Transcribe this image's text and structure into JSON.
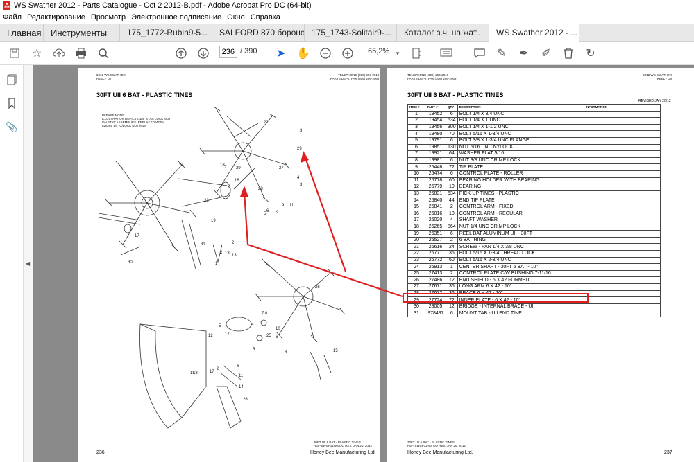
{
  "window": {
    "title": "WS Swather 2012 - Parts Catalogue - Oct 2 2012-B.pdf - Adobe Acrobat Pro DC (64-bit)"
  },
  "menu": [
    "Файл",
    "Редактирование",
    "Просмотр",
    "Электронное подписание",
    "Окно",
    "Справка"
  ],
  "tabs": {
    "home": "Главная",
    "tools": "Инструменты",
    "docs": [
      "175_1772-Rubin9-5...",
      "SALFORD 870 бороно...",
      "175_1743-Solitair9-...",
      "Каталог з.ч. на жат..."
    ],
    "active": "WS Swather 2012 - ...",
    "close": "×"
  },
  "toolbar": {
    "page_current": "236",
    "page_total": "/  390",
    "zoom": "65,2%"
  },
  "left_page": {
    "header_left_1": "2012 WS SWATHER",
    "header_left_2": "REEL - UII",
    "header_right_1": "TELEPHONE (306) 296-2019",
    "header_right_2": "PARTS DEPT. FAX (306) 296-2069",
    "title": "30FT UII 6 BAT - PLASTIC TINES",
    "note": [
      "PLEASE NOTE:",
      "ILLUSTRATION DEPICTS 1/4\" STAR LOCK NUT",
      "ON STAR ASSEMBLIES. REPLACED WITH",
      "826265 1/4\" C/LOCK NUT (#18)"
    ],
    "footer_ref_1": "30FT UII 6 BAT - PLASTIC TINES",
    "footer_ref_2": "REF-SWSP12WS DO REV. JAN 20, 2012",
    "page_no": "236",
    "company": "Honey Bee Manufacturing Ltd.",
    "callouts": [
      "22",
      "17",
      "3",
      "29",
      "18",
      "24",
      "18",
      "29",
      "27",
      "28",
      "4",
      "3",
      "9",
      "5",
      "23",
      "6",
      "9",
      "11",
      "19",
      "17",
      "31",
      "2",
      "1",
      "2",
      "13",
      "30",
      "13",
      "26",
      "5",
      "17",
      "4",
      "7",
      "8",
      "10",
      "5",
      "25",
      "6",
      "8",
      "12",
      "18",
      "17",
      "11",
      "6",
      "14",
      "18",
      "2",
      "26",
      "15"
    ]
  },
  "right_page": {
    "header_left_1": "TELEPHONE (306) 296-2019",
    "header_left_2": "PARTS DEPT. FAX (306) 296-2069",
    "header_right_1": "2012 WS SWATHER",
    "header_right_2": "REEL - UII",
    "title": "30FT UII 6 BAT - PLASTIC TINES",
    "revised": "REVISED JAN 20/12",
    "columns": [
      "ITEM #",
      "PART #",
      "QTY",
      "DESCRIPTION",
      "INFORMATION"
    ],
    "rows": [
      [
        "1",
        "19452",
        "6",
        "BOLT 1/4 X 3/4 UNC",
        ""
      ],
      [
        "2",
        "19454",
        "534",
        "BOLT 1/4 X 1 UNC",
        ""
      ],
      [
        "3",
        "19456",
        "300",
        "BOLT 1/4 X 1-1/2 UNC",
        ""
      ],
      [
        "4",
        "19480",
        "70",
        "BOLT 5/16 X 1-3/4 UNC",
        ""
      ],
      [
        "5",
        "19791",
        "6",
        "BOLT 3/8 X 1-3/4 UNC FLANGE",
        ""
      ],
      [
        "6",
        "19851",
        "130",
        "NUT 5/16 UNC NYLOCK",
        ""
      ],
      [
        "7",
        "19921",
        "64",
        "WASHER FLAT 5/16",
        ""
      ],
      [
        "8",
        "19981",
        "6",
        "NUT 3/8 UNC CRIMP LOCK",
        ""
      ],
      [
        "9",
        "25446",
        "72",
        "TIP PLATE",
        ""
      ],
      [
        "10",
        "25474",
        "6",
        "CONTROL PLATE - ROLLER",
        ""
      ],
      [
        "11",
        "25778",
        "60",
        "BEARING HOLDER WITH BEARING",
        ""
      ],
      [
        "12",
        "25779",
        "10",
        "BEARING",
        ""
      ],
      [
        "13",
        "25831",
        "534",
        "PICK-UP TINES - PLASTIC",
        ""
      ],
      [
        "14",
        "25840",
        "44",
        "END TIP PLATE",
        ""
      ],
      [
        "15",
        "25841",
        "2",
        "CONTROL ARM - FIXED",
        ""
      ],
      [
        "16",
        "26016",
        "10",
        "CONTROL ARM - REGULAR",
        ""
      ],
      [
        "17",
        "26020",
        "4",
        "SHAFT WASHER",
        ""
      ],
      [
        "18",
        "26265",
        "864",
        "NUT 1/4 UNC CRIMP LOCK",
        ""
      ],
      [
        "19",
        "26351",
        "6",
        "REEL BAT ALUMINUM UII - 30FT",
        ""
      ],
      [
        "20",
        "26527",
        "2",
        "6 BAT RING",
        ""
      ],
      [
        "21",
        "26616",
        "24",
        "SCREW - PAN 1/4 X 3/8 UNC",
        ""
      ],
      [
        "22",
        "26771",
        "36",
        "BOLT 5/16 X 1-3/4 THREAD LOCK",
        ""
      ],
      [
        "23",
        "26772",
        "60",
        "BOLT 5/16 X 2-3/4 UNC",
        ""
      ],
      [
        "24",
        "26913",
        "1",
        "CENTER SHAFT - 30FT 6 BAT - 10\"",
        ""
      ],
      [
        "25",
        "27413",
        "2",
        "CONTROL PLATE C/W BUSHING 7-11/16",
        ""
      ],
      [
        "26",
        "27486",
        "12",
        "END SHIELD - 6 X 42 FORMED",
        ""
      ],
      [
        "27",
        "27671",
        "36",
        "LONG ARM 6 X 42  - 10\"",
        ""
      ],
      [
        "28",
        "27672",
        "36",
        "BRACE 6 X 42 - 10\"",
        ""
      ],
      [
        "29",
        "27724",
        "72",
        "INNER PLATE - 6 X 42  - 10\"",
        ""
      ],
      [
        "30",
        "28005",
        "12",
        "BRIDGE - INTERNAL BRACE - UII",
        ""
      ],
      [
        "31",
        "P78497",
        "6",
        "MOUNT TAB - UII END TINE",
        ""
      ]
    ],
    "footer_ref_1": "30FT UII 6 BAT - PLASTIC TINES",
    "footer_ref_2": "REF-SWSP12WS DO REV. JAN 20, 2012",
    "company": "Honey Bee Manufacturing Ltd.",
    "page_no": "237"
  },
  "colors": {
    "highlight": "#e02020",
    "viewer_bg": "#8a8a8a",
    "tabbar": "#e8e8e8"
  }
}
